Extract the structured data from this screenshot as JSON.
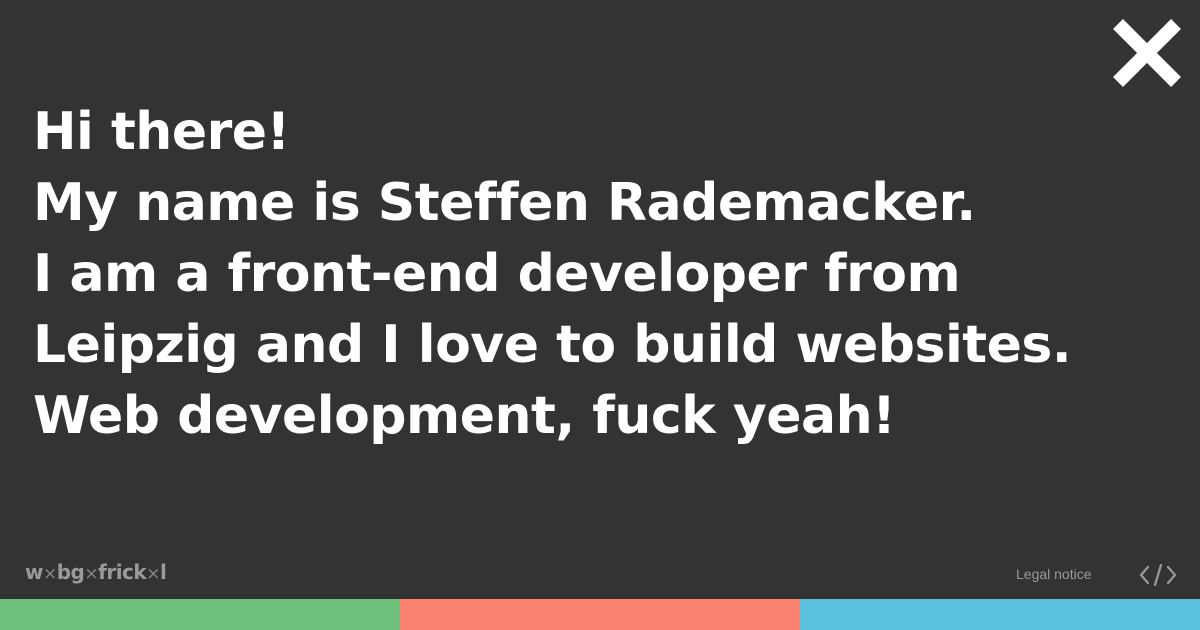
{
  "header": {
    "close_icon": "close-icon",
    "close_color": "#ffffff"
  },
  "intro": {
    "lines": [
      "Hi there!",
      "My name is Steffen Rademacker.",
      "I am a front-end developer from",
      "Leipzig and I love to build websites.",
      "Web development, fuck yeah!"
    ]
  },
  "footer": {
    "logo": {
      "parts": [
        "w",
        "bg",
        "frick",
        "l"
      ],
      "separator": "×"
    },
    "legal_label": "Legal notice",
    "code_icon": "code-icon"
  },
  "colors": {
    "background": "#333333",
    "text": "#ffffff",
    "muted": "#9a9a9a",
    "bar": [
      "#6fc07b",
      "#f98370",
      "#5bc1dc"
    ]
  }
}
